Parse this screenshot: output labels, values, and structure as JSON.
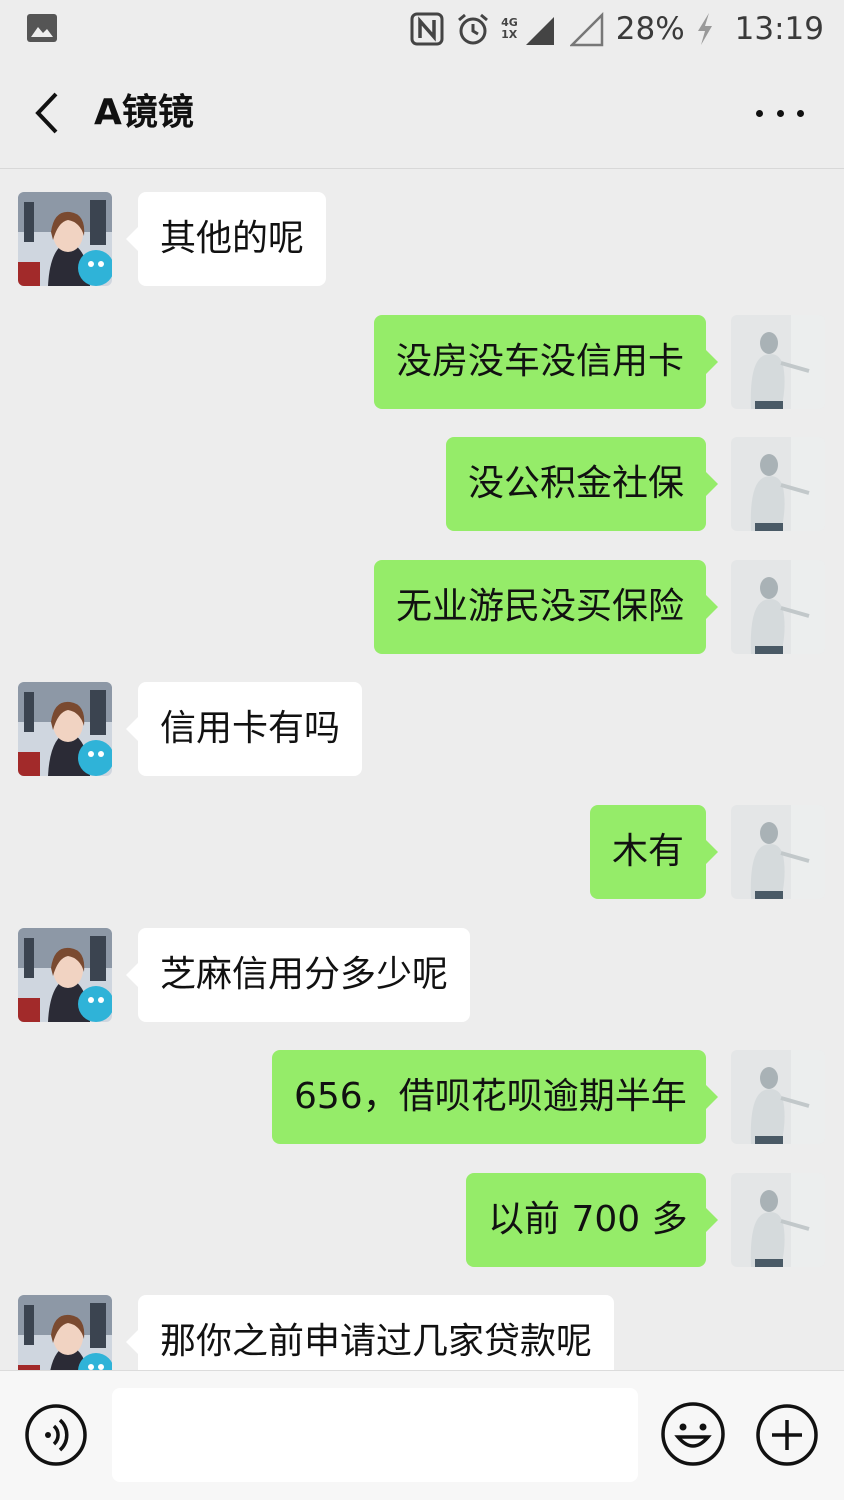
{
  "status_bar": {
    "network_top": "4G",
    "network_bottom": "1X",
    "battery": "28%",
    "time": "13:19",
    "icons": [
      "gallery-icon",
      "nfc-icon",
      "alarm-icon",
      "signal-icon",
      "signal-empty-icon",
      "charging-icon"
    ]
  },
  "header": {
    "title": "A镜镜",
    "back_icon": "chevron-left-icon",
    "more_icon": "more-dots-icon"
  },
  "messages": [
    {
      "side": "in",
      "text": "其他的呢"
    },
    {
      "side": "out",
      "text": "没房没车没信用卡"
    },
    {
      "side": "out",
      "text": "没公积金社保"
    },
    {
      "side": "out",
      "text": "无业游民没买保险"
    },
    {
      "side": "in",
      "text": "信用卡有吗"
    },
    {
      "side": "out",
      "text": "木有"
    },
    {
      "side": "in",
      "text": "芝麻信用分多少呢"
    },
    {
      "side": "out",
      "text": "656，借呗花呗逾期半年"
    },
    {
      "side": "out",
      "text": "以前 700 多"
    },
    {
      "side": "in",
      "text": "那你之前申请过几家贷款呢"
    }
  ],
  "input_bar": {
    "placeholder": "",
    "voice_icon": "voice-icon",
    "emoji_icon": "emoji-icon",
    "plus_icon": "plus-icon"
  },
  "colors": {
    "background": "#ededed",
    "outgoing_bubble": "#95ec69",
    "incoming_bubble": "#ffffff"
  }
}
